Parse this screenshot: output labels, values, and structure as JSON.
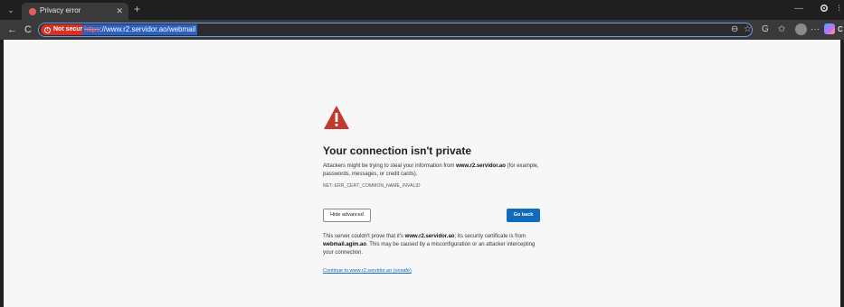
{
  "tab": {
    "title": "Privacy error",
    "close_glyph": "✕",
    "new_tab_glyph": "+",
    "menu_glyph": "⌄"
  },
  "window": {
    "minimize_glyph": "—",
    "edge_glyph": "⁝"
  },
  "toolbar": {
    "back_glyph": "←",
    "refresh_glyph": "C",
    "not_secure_label": "Not secure",
    "url_protocol": "https",
    "url_rest": "://www.r2.servidor.ao/webmail",
    "zoom_glyph": "⊖",
    "favorite_glyph": "☆",
    "split_glyph": "G",
    "collections_glyph": "✩",
    "more_glyph": "···",
    "copilot_text": "C"
  },
  "error_page": {
    "heading": "Your connection isn't private",
    "desc_before": "Attackers might be trying to steal your information from ",
    "desc_host": "www.r2.servidor.ao",
    "desc_after": " (for example, passwords, messages, or credit cards).",
    "error_code": "NET::ERR_CERT_COMMON_NAME_INVALID",
    "hide_advanced_label": "Hide advanced",
    "go_back_label": "Go back",
    "adv_1": "This server couldn't prove that it's ",
    "adv_host": "www.r2.servidor.ao",
    "adv_2": "; its security certificate is from ",
    "adv_cert_host": "webmail.agim.ao",
    "adv_3": ". This may be caused by a misconfiguration or an attacker intercepting your connection.",
    "proceed_link": "Continue to www.r2.servidor.ao (unsafe)"
  },
  "colors": {
    "warning": "#c0392b",
    "primary_button": "#0f6cbd",
    "not_secure": "#d93025"
  }
}
